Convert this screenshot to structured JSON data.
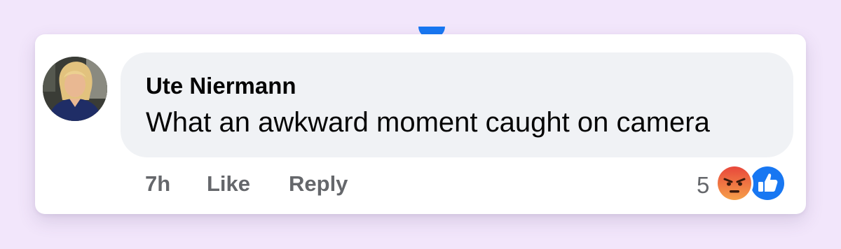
{
  "comment": {
    "author": "Ute Niermann",
    "text": "What an awkward moment caught on camera",
    "time": "7h",
    "like_label": "Like",
    "reply_label": "Reply",
    "reaction_count": "5",
    "reactions": [
      "angry-reaction-icon",
      "like-reaction-icon"
    ]
  },
  "colors": {
    "page_background": "#f2e6fb",
    "card_background": "#ffffff",
    "bubble_background": "#f0f2f5",
    "primary_text": "#050505",
    "secondary_text": "#65676b",
    "like_blue": "#1877f2",
    "angry_orange": "#f0663a"
  }
}
